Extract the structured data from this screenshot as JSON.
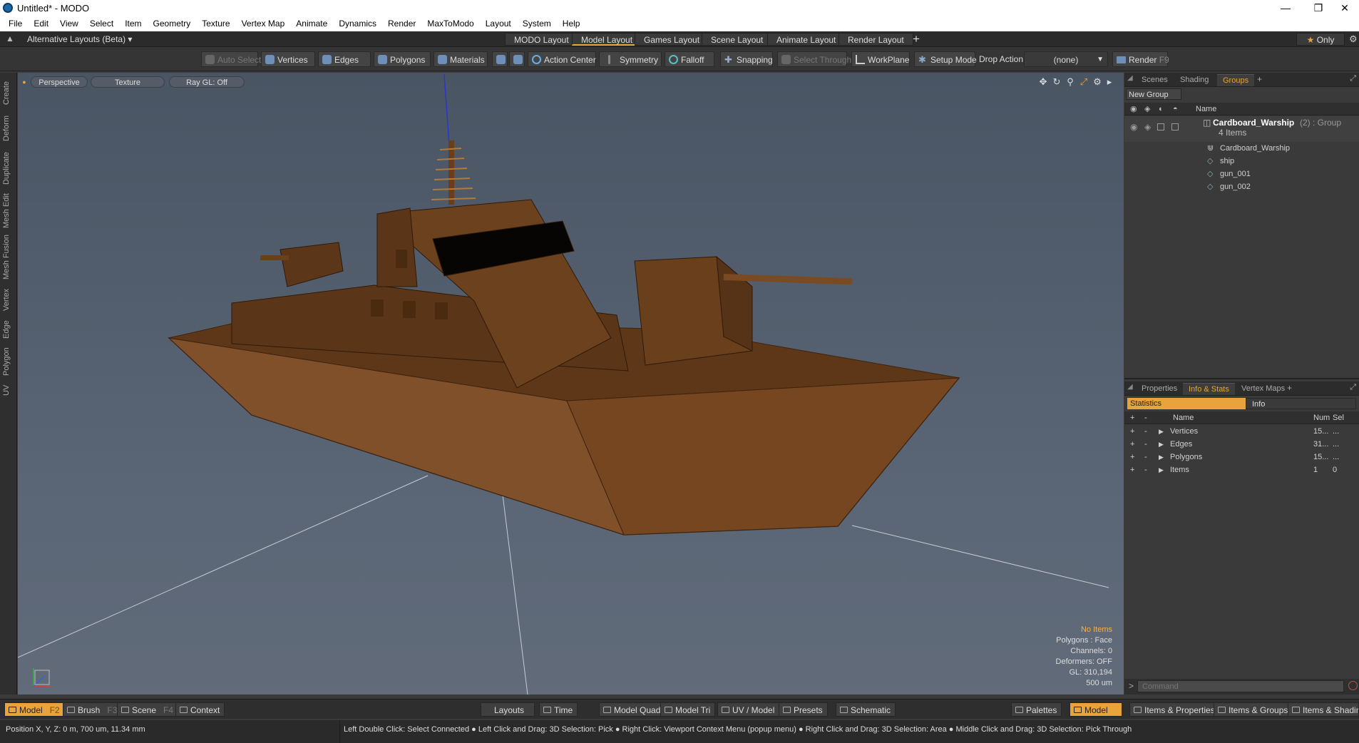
{
  "window": {
    "title": "Untitled* - MODO"
  },
  "menu": [
    "File",
    "Edit",
    "View",
    "Select",
    "Item",
    "Geometry",
    "Texture",
    "Vertex Map",
    "Animate",
    "Dynamics",
    "Render",
    "MaxToModo",
    "Layout",
    "System",
    "Help"
  ],
  "layoutbar": {
    "alt_layouts": "Alternative Layouts (Beta)",
    "tabs": [
      "MODO Layout",
      "Model Layout",
      "Games Layout",
      "Scene Layout",
      "Animate Layout",
      "Render Layout"
    ],
    "active_tab": "Model Layout",
    "add": "+",
    "only": "Only"
  },
  "toolbar": {
    "auto_select": "Auto Select",
    "vertices": "Vertices",
    "edges": "Edges",
    "polygons": "Polygons",
    "materials": "Materials",
    "action_center": "Action Center",
    "symmetry": "Symmetry",
    "falloff": "Falloff",
    "snapping": "Snapping",
    "select_through": "Select Through",
    "workplane": "WorkPlane",
    "setup_mode": "Setup Mode",
    "drop_action": "Drop Action",
    "drop_value": "(none)",
    "render": "Render",
    "render_key": "F9"
  },
  "left_tabs": [
    "Create",
    "Deform",
    "Duplicate",
    "Mesh Edit",
    "Mesh Fusion",
    "Vertex",
    "Edge",
    "Polygon",
    "UV"
  ],
  "viewport": {
    "view": "Perspective",
    "shading": "Texture",
    "raygl": "Ray GL: Off",
    "info": {
      "items": "No Items",
      "polygons": "Polygons : Face",
      "channels": "Channels: 0",
      "deformers": "Deformers: OFF",
      "gl": "GL: 310,194",
      "scale": "500 um"
    }
  },
  "scene_panel": {
    "tabs": [
      "Scenes",
      "Shading",
      "Groups"
    ],
    "active": "Groups",
    "new_group": "New Group",
    "name_header": "Name",
    "group_name": "Cardboard_Warship",
    "group_suffix": "(2) : Group",
    "group_count": "4 Items",
    "items": [
      "Cardboard_Warship",
      "ship",
      "gun_001",
      "gun_002"
    ]
  },
  "props_panel": {
    "tabs": [
      "Properties",
      "Info & Stats",
      "Vertex Maps"
    ],
    "active": "Info & Stats",
    "subtabs": [
      "Statistics",
      "Info"
    ],
    "headers": {
      "name": "Name",
      "num": "Num",
      "sel": "Sel"
    },
    "rows": [
      {
        "name": "Vertices",
        "num": "15...",
        "sel": "..."
      },
      {
        "name": "Edges",
        "num": "31...",
        "sel": "..."
      },
      {
        "name": "Polygons",
        "num": "15...",
        "sel": "..."
      },
      {
        "name": "Items",
        "num": "1",
        "sel": "0"
      }
    ],
    "command_placeholder": "Command"
  },
  "bottombar": {
    "model": "Model",
    "model_key": "F2",
    "brush": "Brush",
    "brush_key": "F3",
    "scene": "Scene",
    "scene_key": "F4",
    "context": "Context",
    "layouts": "Layouts",
    "time": "Time",
    "model_quad": "Model Quad",
    "model_tri": "Model Tri",
    "uv_model": "UV / Model",
    "presets": "Presets",
    "schematic": "Schematic",
    "palettes": "Palettes",
    "model_right": "Model",
    "items_props": "Items & Properties",
    "items_groups": "Items & Groups",
    "items_shading": "Items & Shading"
  },
  "status": {
    "position": "Position X, Y, Z:   0 m, 700 um, 11.34 mm",
    "hints": "Left Double Click: Select Connected ● Left Click and Drag: 3D Selection: Pick ● Right Click: Viewport Context Menu (popup menu) ● Right Click and Drag: 3D Selection: Area ● Middle Click and Drag: 3D Selection: Pick Through"
  },
  "colors": {
    "accent": "#e8a33a",
    "hull": "#7a4a22",
    "viewport_top": "#4a5564"
  }
}
